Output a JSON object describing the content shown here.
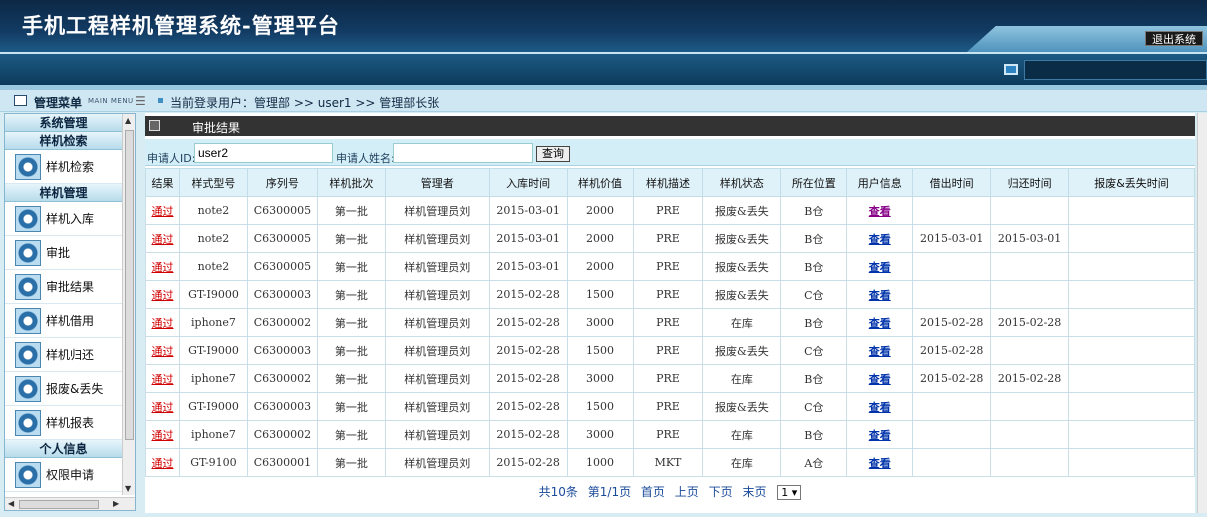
{
  "header": {
    "title": "手机工程样机管理系统-管理平台",
    "logout": "退出系统"
  },
  "menubar": {
    "title": "管理菜单",
    "title_en": "MAIN MENU",
    "current_user": "当前登录用户：管理部 >> user1 >> 管理部长张"
  },
  "sidebar": {
    "sections": [
      {
        "label": "系统管理",
        "items": []
      },
      {
        "label": "样机检索",
        "items": [
          "样机检索"
        ]
      },
      {
        "label": "样机管理",
        "items": [
          "样机入库",
          "审批",
          "审批结果",
          "样机借用",
          "样机归还",
          "报废&丢失",
          "样机报表"
        ]
      },
      {
        "label": "个人信息",
        "items": [
          "权限申请"
        ]
      }
    ]
  },
  "panel": {
    "title": "审批结果"
  },
  "search": {
    "id_label": "申请人ID:",
    "id_value": "user2",
    "name_label": "申请人姓名:",
    "name_value": "",
    "button": "查询"
  },
  "table": {
    "headers": [
      "结果",
      "样式型号",
      "序列号",
      "样机批次",
      "管理者",
      "入库时间",
      "样机价值",
      "样机描述",
      "样机状态",
      "所在位置",
      "用户信息",
      "借出时间",
      "归还时间",
      "报废&丢失时间"
    ],
    "rows": [
      [
        "通过",
        "note2",
        "C6300005",
        "第一批",
        "样机管理员刘",
        "2015-03-01",
        "2000",
        "PRE",
        "报废&丢失",
        "B仓",
        "查看",
        "",
        "",
        ""
      ],
      [
        "通过",
        "note2",
        "C6300005",
        "第一批",
        "样机管理员刘",
        "2015-03-01",
        "2000",
        "PRE",
        "报废&丢失",
        "B仓",
        "查看",
        "2015-03-01",
        "2015-03-01",
        ""
      ],
      [
        "通过",
        "note2",
        "C6300005",
        "第一批",
        "样机管理员刘",
        "2015-03-01",
        "2000",
        "PRE",
        "报废&丢失",
        "B仓",
        "查看",
        "",
        "",
        ""
      ],
      [
        "通过",
        "GT-I9000",
        "C6300003",
        "第一批",
        "样机管理员刘",
        "2015-02-28",
        "1500",
        "PRE",
        "报废&丢失",
        "C仓",
        "查看",
        "",
        "",
        ""
      ],
      [
        "通过",
        "iphone7",
        "C6300002",
        "第一批",
        "样机管理员刘",
        "2015-02-28",
        "3000",
        "PRE",
        "在库",
        "B仓",
        "查看",
        "2015-02-28",
        "2015-02-28",
        ""
      ],
      [
        "通过",
        "GT-I9000",
        "C6300003",
        "第一批",
        "样机管理员刘",
        "2015-02-28",
        "1500",
        "PRE",
        "报废&丢失",
        "C仓",
        "查看",
        "2015-02-28",
        "",
        ""
      ],
      [
        "通过",
        "iphone7",
        "C6300002",
        "第一批",
        "样机管理员刘",
        "2015-02-28",
        "3000",
        "PRE",
        "在库",
        "B仓",
        "查看",
        "2015-02-28",
        "2015-02-28",
        ""
      ],
      [
        "通过",
        "GT-I9000",
        "C6300003",
        "第一批",
        "样机管理员刘",
        "2015-02-28",
        "1500",
        "PRE",
        "报废&丢失",
        "C仓",
        "查看",
        "",
        "",
        ""
      ],
      [
        "通过",
        "iphone7",
        "C6300002",
        "第一批",
        "样机管理员刘",
        "2015-02-28",
        "3000",
        "PRE",
        "在库",
        "B仓",
        "查看",
        "",
        "",
        ""
      ],
      [
        "通过",
        "GT-9100",
        "C6300001",
        "第一批",
        "样机管理员刘",
        "2015-02-28",
        "1000",
        "MKT",
        "在库",
        "A仓",
        "查看",
        "",
        "",
        ""
      ]
    ]
  },
  "pager": {
    "total": "共10条",
    "page": "第1/1页",
    "first": "首页",
    "prev": "上页",
    "next": "下页",
    "last": "末页",
    "select_value": "1 ▾"
  },
  "colors": {
    "header_bg": "#123b63",
    "pass_text": "#d10000",
    "link": "#0033aa"
  }
}
